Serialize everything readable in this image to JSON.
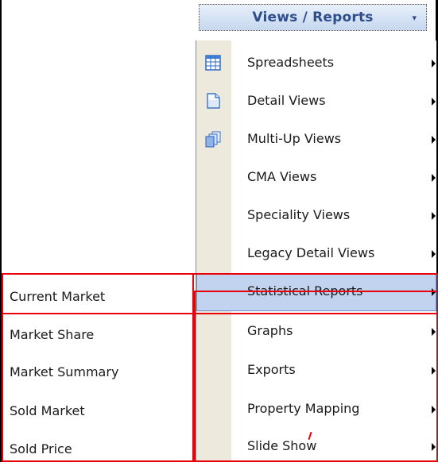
{
  "header": {
    "title": "Views / Reports",
    "caret": "▾"
  },
  "menu": {
    "items": [
      {
        "label": "Spreadsheets",
        "icon": "grid-icon"
      },
      {
        "label": "Detail Views",
        "icon": "document-icon"
      },
      {
        "label": "Multi-Up Views",
        "icon": "stacked-pages-icon"
      },
      {
        "label": "CMA Views"
      },
      {
        "label": "Speciality Views"
      },
      {
        "label": "Legacy Detail Views"
      },
      {
        "label": "Statistical Reports",
        "highlighted": true
      },
      {
        "label": "Graphs"
      },
      {
        "label": "Exports"
      },
      {
        "label": "Property Mapping"
      },
      {
        "label": "Slide Show"
      }
    ]
  },
  "submenu": {
    "items": [
      "Current Market",
      "Market Share",
      "Market Summary",
      "Sold Market",
      "Sold Price"
    ]
  },
  "colors": {
    "highlight": "#c2d3ef",
    "gutter": "#ede9dd",
    "header_text": "#2e4d8a",
    "annotation": "#e8000b"
  }
}
